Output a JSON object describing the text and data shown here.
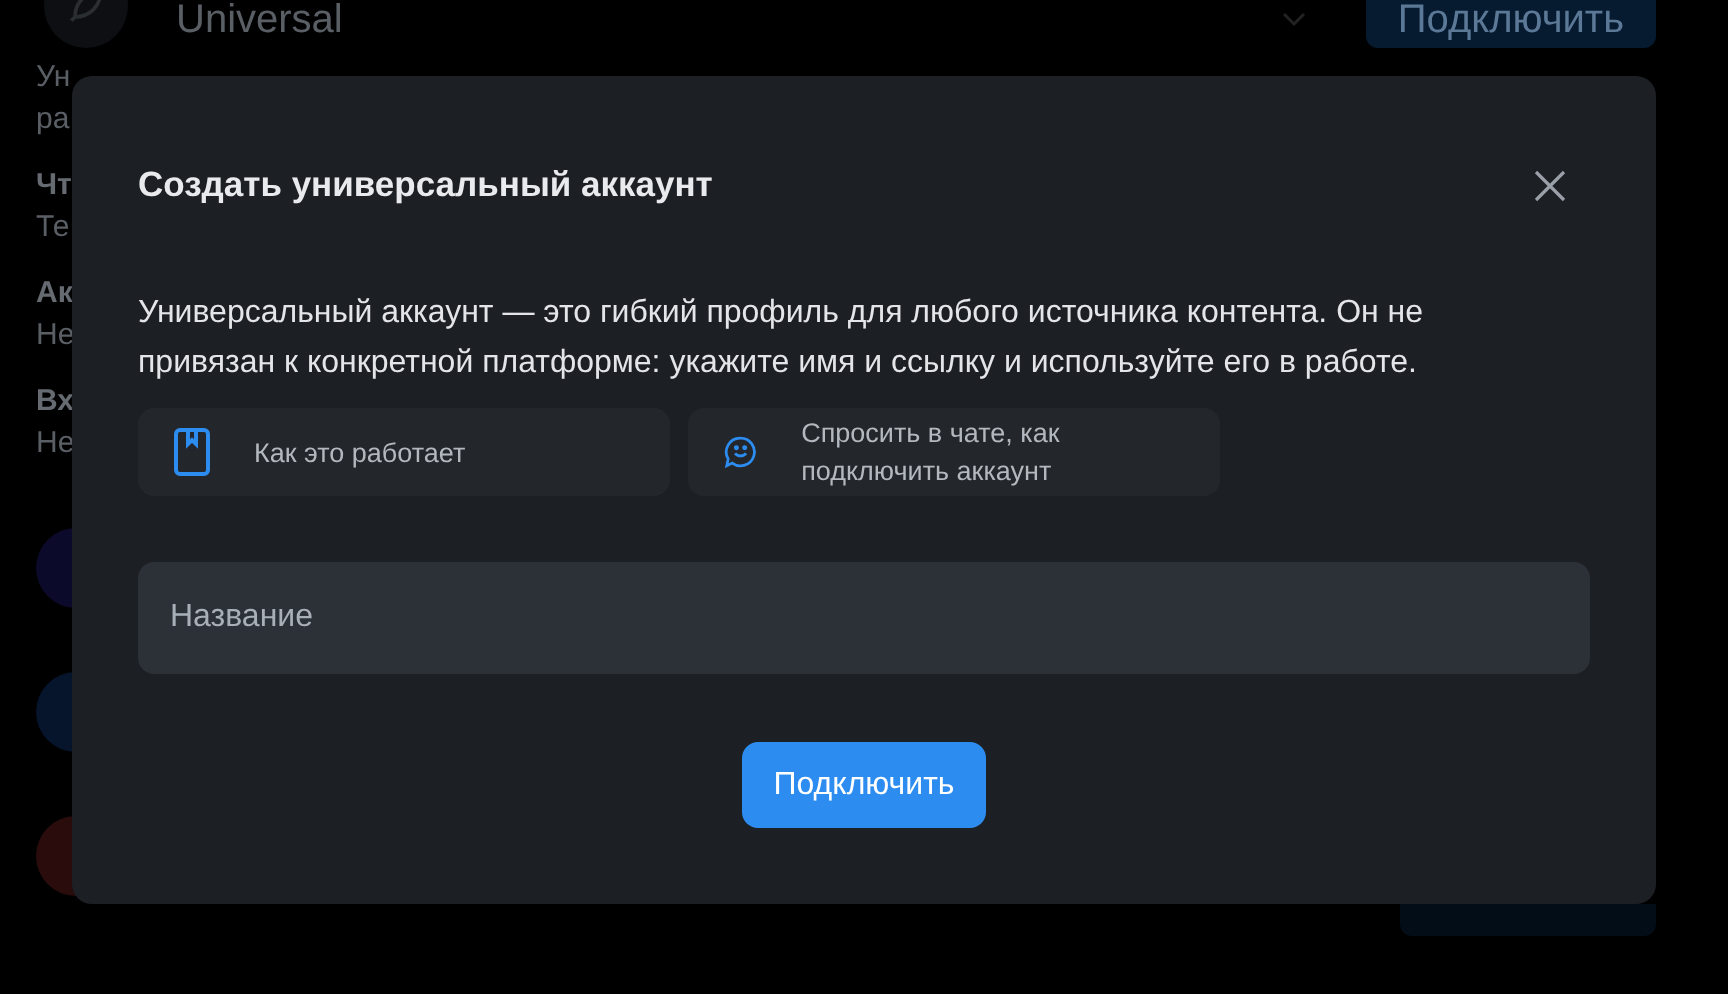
{
  "background": {
    "header": {
      "title": "Universal",
      "button": "Подключить"
    },
    "side_texts": [
      {
        "text": "Ун",
        "bold": false
      },
      {
        "text": "ра",
        "bold": false
      },
      {
        "text": "Чт",
        "bold": true
      },
      {
        "text": "Те",
        "bold": false
      },
      {
        "text": "Ак",
        "bold": true
      },
      {
        "text": "Не",
        "bold": false
      },
      {
        "text": "Вх",
        "bold": true
      },
      {
        "text": "Не",
        "bold": false
      }
    ],
    "avatars": [
      {
        "color": "#0c0a2a"
      },
      {
        "color": "#06142c"
      },
      {
        "color": "#2a0c0c"
      }
    ]
  },
  "dialog": {
    "title": "Создать универсальный аккаунт",
    "description": "Универсальный аккаунт — это гибкий профиль для любого источника контента. Он не привязан к конкретной платформе: укажите имя и ссылку и используйте его в работе.",
    "help_links": [
      {
        "kind": "guide",
        "label": "Как это работает"
      },
      {
        "kind": "chat",
        "label": "Спросить в чате, как подключить аккаунт"
      }
    ],
    "name_field": {
      "placeholder": "Название"
    },
    "submit": "Подключить"
  }
}
